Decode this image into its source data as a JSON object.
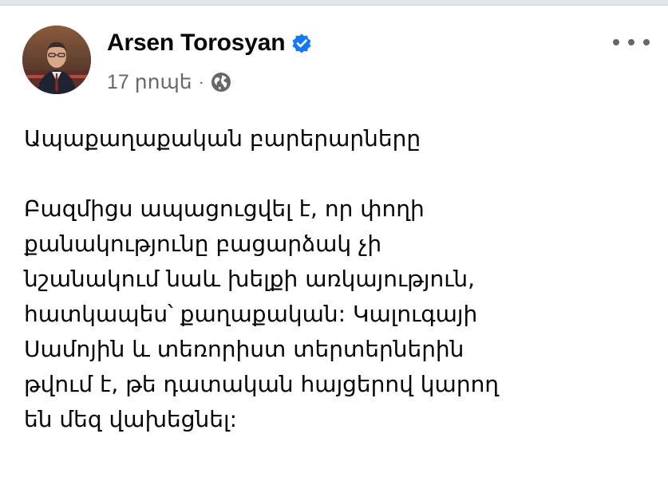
{
  "post": {
    "author": "Arsen Torosyan",
    "verified": true,
    "timestamp": "17 րոպե",
    "separator": "·",
    "audience_icon": "globe-icon",
    "more_icon": "more-options-icon",
    "title": "Ապաքաղաքական բարերարները",
    "body_lines": [
      "Բազմիցս ապացուցվել է, որ փողի",
      "քանակությունը բացարձակ չի",
      "նշանակում նաև խելքի առկայություն,",
      "հատկապես՝ քաղաքական: Կալուգայի",
      "Սամոյին և տեռորիստ տերտերներին",
      "թվում է, թե դատական հայցերով կարող",
      "են մեզ վախեցնել:"
    ]
  },
  "colors": {
    "verified_badge": "#1877f2",
    "meta_text": "#65676b",
    "text": "#050505"
  }
}
